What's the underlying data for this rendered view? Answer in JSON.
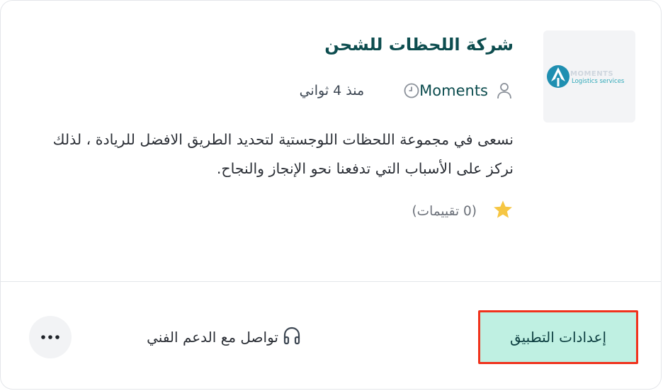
{
  "app": {
    "title": "شركة اللحظات للشحن",
    "author": "Moments",
    "published": "منذ 4 ثواني",
    "description": "نسعى في مجموعة اللحظات اللوجستية لتحديد الطريق الافضل للريادة ، لذلك نركز على الأسباب التي تدفعنا نحو الإنجاز والنجاح.",
    "rating_text": "(0 تقييمات)",
    "logo": {
      "wordmark": "MOMENTS",
      "tagline": "Logistics services"
    }
  },
  "actions": {
    "settings_label": "إعدادات التطبيق",
    "support_label": "تواصل مع الدعم الفني",
    "more_icon": "more-dots-icon"
  },
  "icons": {
    "author": "user-icon",
    "time": "clock-icon",
    "rating": "star-icon",
    "support": "headphones-icon"
  },
  "colors": {
    "title": "#0d4d4f",
    "button_bg": "#bff0e2",
    "button_highlight_border": "#f0321c",
    "star": "#f6c643",
    "logo_teal": "#31a9b9"
  }
}
